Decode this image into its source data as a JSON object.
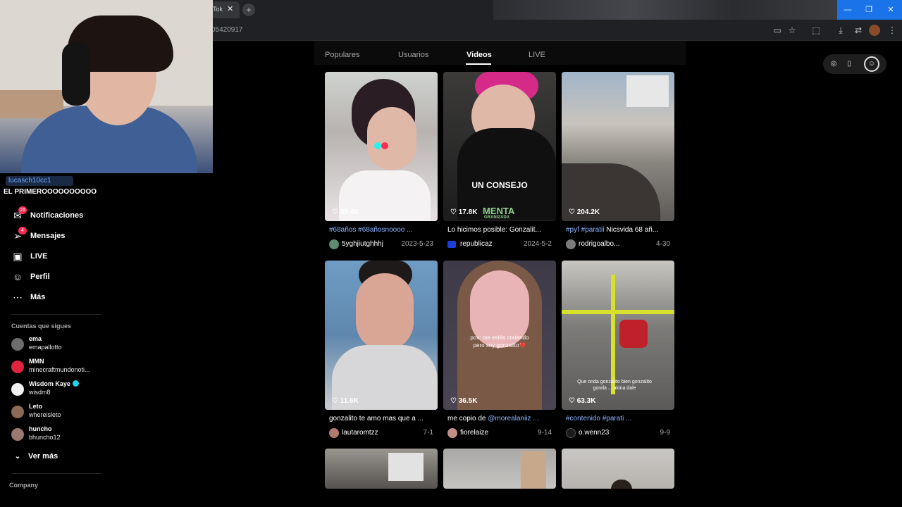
{
  "browser": {
    "tab_title": "Tok",
    "tab_close": "✕",
    "new_tab": "+",
    "url_fragment": "05420917",
    "window_controls": [
      "—",
      "❐",
      "✕"
    ]
  },
  "stream_chat": {
    "username": "lucasch10cc1",
    "message": "EL PRIMEROOOOOOOOOO"
  },
  "sidebar": {
    "nav": [
      {
        "label": "Notificaciones",
        "icon": "bell-icon",
        "badge": "16"
      },
      {
        "label": "Mensajes",
        "icon": "paper-plane-icon",
        "badge": "4"
      },
      {
        "label": "LIVE",
        "icon": "tv-icon"
      },
      {
        "label": "Perfil",
        "icon": "profile-icon"
      },
      {
        "label": "Más",
        "icon": "more-icon"
      }
    ],
    "following_title": "Cuentas que sigues",
    "following": [
      {
        "name": "ema",
        "user": "emapallotto"
      },
      {
        "name": "MMN",
        "user": "minecraftmundonoti..."
      },
      {
        "name": "Wisdom Kaye",
        "user": "wisdm8"
      },
      {
        "name": "Leto",
        "user": "whereisleto"
      },
      {
        "name": "huncho",
        "user": "bhuncho12"
      }
    ],
    "see_more": "Ver más",
    "company": "Company"
  },
  "tabs": [
    "Populares",
    "Usuarios",
    "Videos",
    "LIVE"
  ],
  "active_tab": "Videos",
  "videos": [
    {
      "likes": "39.4K",
      "caption_tags": "#68años #68añosnoooo ...",
      "caption_text": "",
      "user": "5yghjiutghhhj",
      "date": "2023-5-23"
    },
    {
      "likes": "17.8K",
      "caption_tags": "",
      "caption_text": "Lo hicimos posible: Gonzalit...",
      "user": "republicaz",
      "date": "2024-5-2",
      "overlay": "UN CONSEJO",
      "brand": "MENTA",
      "brand_sub": "GRANIZADA"
    },
    {
      "likes": "204.2K",
      "caption_tags": "#pyf #paratii",
      "caption_text": " Nicsvida 68 añ...",
      "user": "rodrigoalbo...",
      "date": "4-30"
    },
    {
      "likes": "11.6K",
      "caption_tags": "",
      "caption_text": "gonzalito te amo mas que a ...",
      "user": "lautaromtzz",
      "date": "7-1"
    },
    {
      "likes": "36.5K",
      "caption_tags": "@morealaniiz ...",
      "caption_text": "me copio de ",
      "user": "fiorelaize",
      "date": "9-14",
      "overlay": "pov: me estás cortando pero soy gonzalito💔"
    },
    {
      "likes": "63.3K",
      "caption_tags": "#contenido #parati ...",
      "caption_text": "",
      "user": "o.wenn23",
      "date": "9-9",
      "overlay": "Que onda gonzalito bien gonzalito gonda ... akina dale"
    }
  ]
}
